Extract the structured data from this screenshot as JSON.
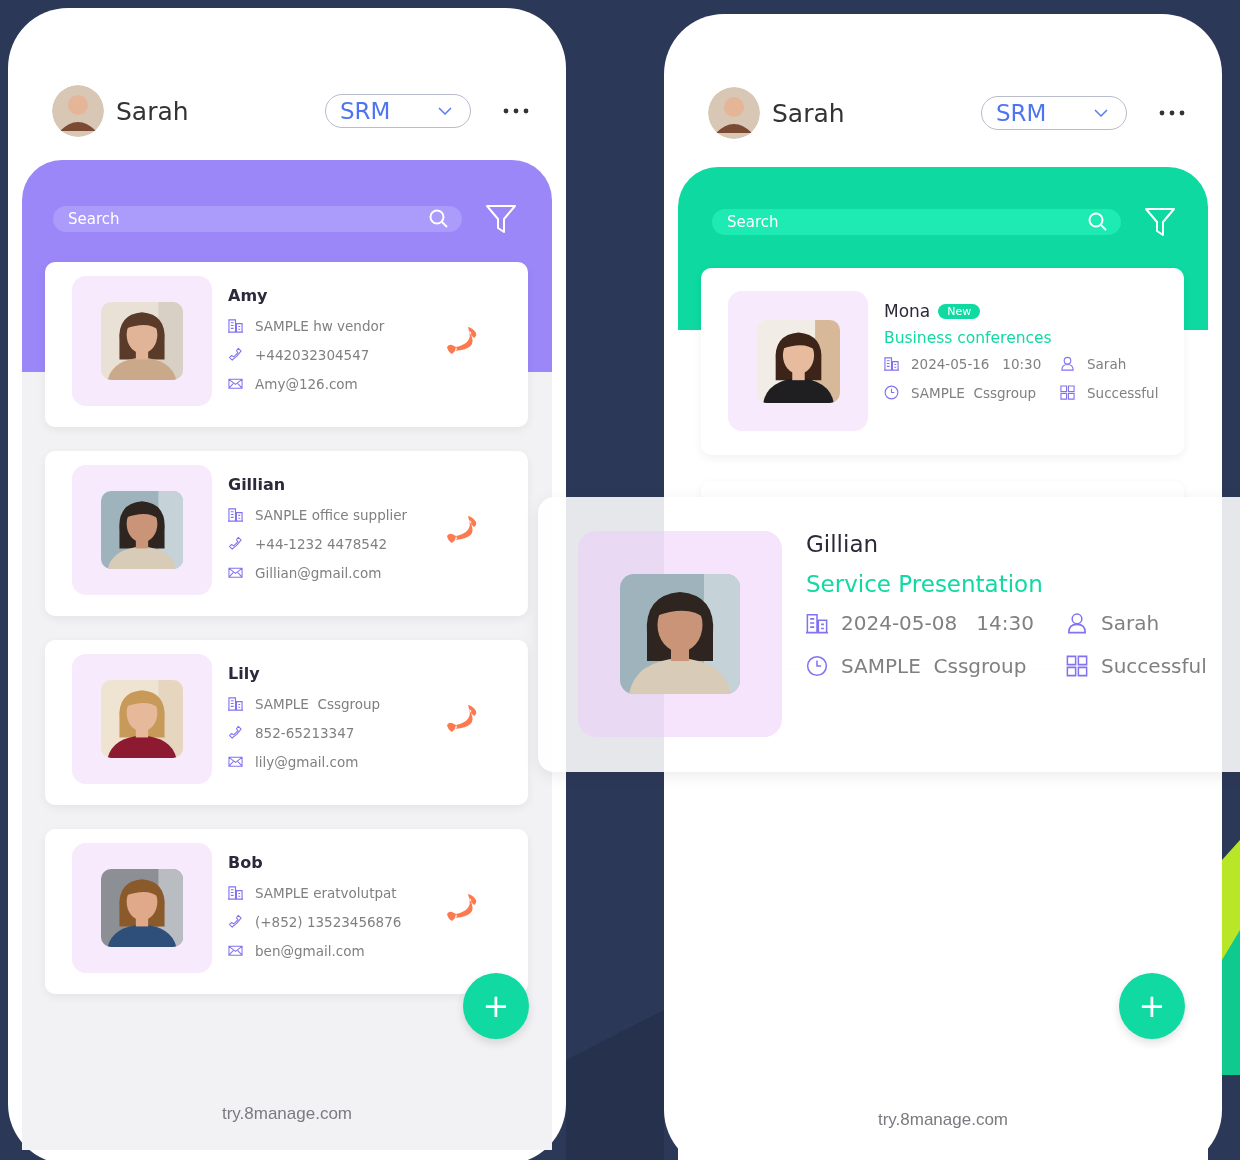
{
  "left_phone": {
    "user": {
      "name": "Sarah"
    },
    "app_switcher": {
      "value": "SRM"
    },
    "search": {
      "placeholder": "Search"
    },
    "contacts": [
      {
        "name": "Amy",
        "company": "SAMPLE hw vendor",
        "phone": "+442032304547",
        "email": "Amy@126.com"
      },
      {
        "name": "Gillian",
        "company": "SANPLE office supplier",
        "phone": "+44-1232 4478542",
        "email": "Gillian@gmail.com"
      },
      {
        "name": "Lily",
        "company": "SAMPLE  Cssgroup",
        "phone": "852-65213347",
        "email": "lily@gmail.com"
      },
      {
        "name": "Bob",
        "company": "SAMPLE eratvolutpat",
        "phone": "(+852) 13523456876",
        "email": "ben@gmail.com"
      }
    ],
    "add_button": {
      "label": "+"
    },
    "footer": "try.8manage.com"
  },
  "right_phone": {
    "user": {
      "name": "Sarah"
    },
    "app_switcher": {
      "value": "SRM"
    },
    "search": {
      "placeholder": "Search"
    },
    "activities": [
      {
        "name": "Mona",
        "badge": "New",
        "title": "Business conferences",
        "datetime": "2024-05-16   10:30",
        "owner": "Sarah",
        "company": "SAMPLE  Cssgroup",
        "status": "Successful"
      }
    ],
    "add_button": {
      "label": "+"
    },
    "footer": "try.8manage.com"
  },
  "dragged_card": {
    "name": "Gillian",
    "title": "Service Presentation",
    "datetime": "2024-05-08   14:30",
    "owner": "Sarah",
    "company": "SAMPLE  Cssgroup",
    "status": "Successful"
  }
}
